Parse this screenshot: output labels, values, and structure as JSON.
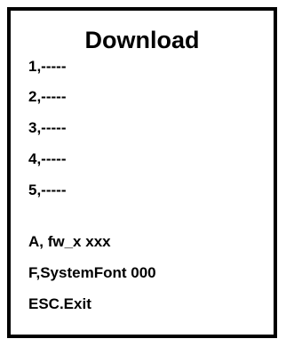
{
  "screen": {
    "title": "Download",
    "slots": [
      "1,-----",
      "2,-----",
      "3,-----",
      "4,-----",
      "5,-----"
    ],
    "options": [
      "A, fw_x xxx",
      "F,SystemFont 000",
      "ESC.Exit"
    ]
  }
}
